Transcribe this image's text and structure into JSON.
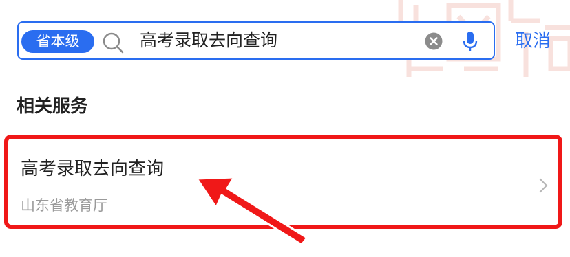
{
  "search": {
    "scope_label": "省本级",
    "query": "高考录取去向查询",
    "cancel_label": "取消"
  },
  "section": {
    "title": "相关服务"
  },
  "results": [
    {
      "title": "高考录取去向查询",
      "department": "山东省教育厅"
    }
  ],
  "icons": {
    "search": "search-icon",
    "clear": "clear-icon",
    "mic": "microphone-icon",
    "chevron": "chevron-right-icon",
    "arrow": "arrow-annotation"
  },
  "colors": {
    "accent": "#2a6df0",
    "highlight": "#f01818",
    "text_primary": "#222222",
    "text_secondary": "#9a9a9a"
  }
}
